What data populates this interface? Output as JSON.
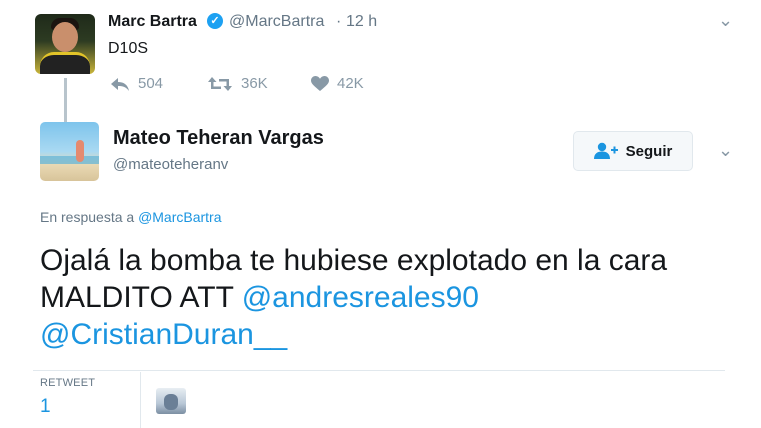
{
  "original_tweet": {
    "name": "Marc Bartra",
    "handle": "@MarcBartra",
    "time": "12 h",
    "text": "D10S",
    "actions": {
      "replies": "504",
      "retweets": "36K",
      "likes": "42K"
    }
  },
  "reply_tweet": {
    "name": "Mateo Teheran Vargas",
    "handle": "@mateoteheranv",
    "follow_label": "Seguir",
    "in_reply_prefix": "En respuesta a",
    "in_reply_mention": "@MarcBartra",
    "text_plain": "Ojalá la bomba te hubiese explotado en la cara MALDITO ATT",
    "mention_1": "@andresreales90",
    "mention_2": "@CristianDuran__",
    "stats": {
      "retweet_label": "RETWEET",
      "retweet_count": "1"
    }
  },
  "icons": {
    "verified": "verified-badge-icon",
    "reply": "reply-icon",
    "retweet": "retweet-icon",
    "like": "heart-icon",
    "follow": "add-user-icon",
    "menu": "chevron-down-icon"
  },
  "colors": {
    "link": "#1b95e0",
    "verified": "#1da1f2",
    "muted": "#657786",
    "icon": "#8899a6"
  }
}
